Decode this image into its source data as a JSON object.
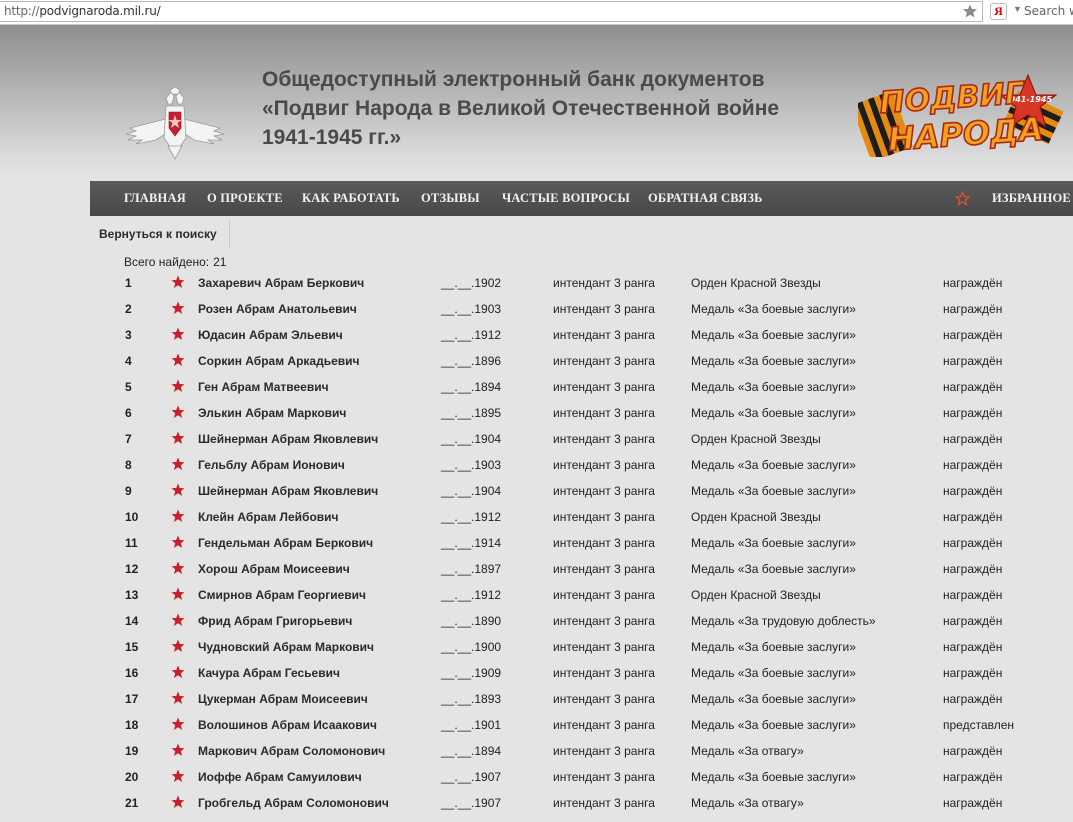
{
  "browser": {
    "url_protocol": "http://",
    "url_host": "podvignaroda.mil.ru/",
    "search_placeholder": "Search w",
    "yandex_label": "Я"
  },
  "header": {
    "title_line1": "Общедоступный электронный банк документов",
    "title_line2": "«Подвиг Народа в Великой Отечественной войне",
    "title_line3": "1941-1945 гг.»",
    "logo_top": "ПОДВИГ",
    "logo_bottom": "НАРОДА",
    "logo_years": "1941-1945"
  },
  "nav": {
    "items": [
      "ГЛАВНАЯ",
      "О ПРОЕКТЕ",
      "КАК РАБОТАТЬ",
      "ОТЗЫВЫ",
      "ЧАСТЫЕ ВОПРОСЫ",
      "ОБРАТНАЯ СВЯЗЬ"
    ],
    "favorites": "ИЗБРАННОЕ"
  },
  "back_link": "Вернуться к поиску",
  "total": {
    "label": "Всего найдено:",
    "count": "21"
  },
  "colors": {
    "star": "#c8202a",
    "nav_bg": "#4f4f4f",
    "title": "#4a4a4a"
  },
  "rows": [
    {
      "num": "1",
      "name": "Захаревич Абрам Беркович",
      "date": "__.__.1902",
      "rank": "интендант 3 ранга",
      "award": "Орден Красной Звезды",
      "status": "награждён"
    },
    {
      "num": "2",
      "name": "Розен Абрам Анатольевич",
      "date": "__.__.1903",
      "rank": "интендант 3 ранга",
      "award": "Медаль «За боевые заслуги»",
      "status": "награждён"
    },
    {
      "num": "3",
      "name": "Юдасин Абрам Эльевич",
      "date": "__.__.1912",
      "rank": "интендант 3 ранга",
      "award": "Медаль «За боевые заслуги»",
      "status": "награждён"
    },
    {
      "num": "4",
      "name": "Соркин Абрам Аркадьевич",
      "date": "__.__.1896",
      "rank": "интендант 3 ранга",
      "award": "Медаль «За боевые заслуги»",
      "status": "награждён"
    },
    {
      "num": "5",
      "name": "Ген Абрам Матвеевич",
      "date": "__.__.1894",
      "rank": "интендант 3 ранга",
      "award": "Медаль «За боевые заслуги»",
      "status": "награждён"
    },
    {
      "num": "6",
      "name": "Элькин Абрам Маркович",
      "date": "__.__.1895",
      "rank": "интендант 3 ранга",
      "award": "Медаль «За боевые заслуги»",
      "status": "награждён"
    },
    {
      "num": "7",
      "name": "Шейнерман Абрам Яковлевич",
      "date": "__.__.1904",
      "rank": "интендант 3 ранга",
      "award": "Орден Красной Звезды",
      "status": "награждён"
    },
    {
      "num": "8",
      "name": "Гельблу Абрам Ионович",
      "date": "__.__.1903",
      "rank": "интендант 3 ранга",
      "award": "Медаль «За боевые заслуги»",
      "status": "награждён"
    },
    {
      "num": "9",
      "name": "Шейнерман Абрам Яковлевич",
      "date": "__.__.1904",
      "rank": "интендант 3 ранга",
      "award": "Медаль «За боевые заслуги»",
      "status": "награждён"
    },
    {
      "num": "10",
      "name": "Клейн Абрам Лейбович",
      "date": "__.__.1912",
      "rank": "интендант 3 ранга",
      "award": "Орден Красной Звезды",
      "status": "награждён"
    },
    {
      "num": "11",
      "name": "Гендельман Абрам Беркович",
      "date": "__.__.1914",
      "rank": "интендант 3 ранга",
      "award": "Медаль «За боевые заслуги»",
      "status": "награждён"
    },
    {
      "num": "12",
      "name": "Хорош Абрам Моисеевич",
      "date": "__.__.1897",
      "rank": "интендант 3 ранга",
      "award": "Медаль «За боевые заслуги»",
      "status": "награждён"
    },
    {
      "num": "13",
      "name": "Смирнов Абрам Георгиевич",
      "date": "__.__.1912",
      "rank": "интендант 3 ранга",
      "award": "Орден Красной Звезды",
      "status": "награждён"
    },
    {
      "num": "14",
      "name": "Фрид Абрам Григорьевич",
      "date": "__.__.1890",
      "rank": "интендант 3 ранга",
      "award": "Медаль «За трудовую доблесть»",
      "status": "награждён"
    },
    {
      "num": "15",
      "name": "Чудновский Абрам Маркович",
      "date": "__.__.1900",
      "rank": "интендант 3 ранга",
      "award": "Медаль «За боевые заслуги»",
      "status": "награждён"
    },
    {
      "num": "16",
      "name": "Качура Абрам Гесьевич",
      "date": "__.__.1909",
      "rank": "интендант 3 ранга",
      "award": "Медаль «За боевые заслуги»",
      "status": "награждён"
    },
    {
      "num": "17",
      "name": "Цукерман Абрам Моисеевич",
      "date": "__.__.1893",
      "rank": "интендант 3 ранга",
      "award": "Медаль «За боевые заслуги»",
      "status": "награждён"
    },
    {
      "num": "18",
      "name": "Волошинов Абрам Исаакович",
      "date": "__.__.1901",
      "rank": "интендант 3 ранга",
      "award": "Медаль «За боевые заслуги»",
      "status": "представлен"
    },
    {
      "num": "19",
      "name": "Маркович Абрам Соломонович",
      "date": "__.__.1894",
      "rank": "интендант 3 ранга",
      "award": "Медаль «За отвагу»",
      "status": "награждён"
    },
    {
      "num": "20",
      "name": "Иоффе Абрам Самуилович",
      "date": "__.__.1907",
      "rank": "интендант 3 ранга",
      "award": "Медаль «За боевые заслуги»",
      "status": "награждён"
    },
    {
      "num": "21",
      "name": "Гробгельд Абрам Соломонович",
      "date": "__.__.1907",
      "rank": "интендант 3 ранга",
      "award": "Медаль «За отвагу»",
      "status": "награждён"
    }
  ]
}
